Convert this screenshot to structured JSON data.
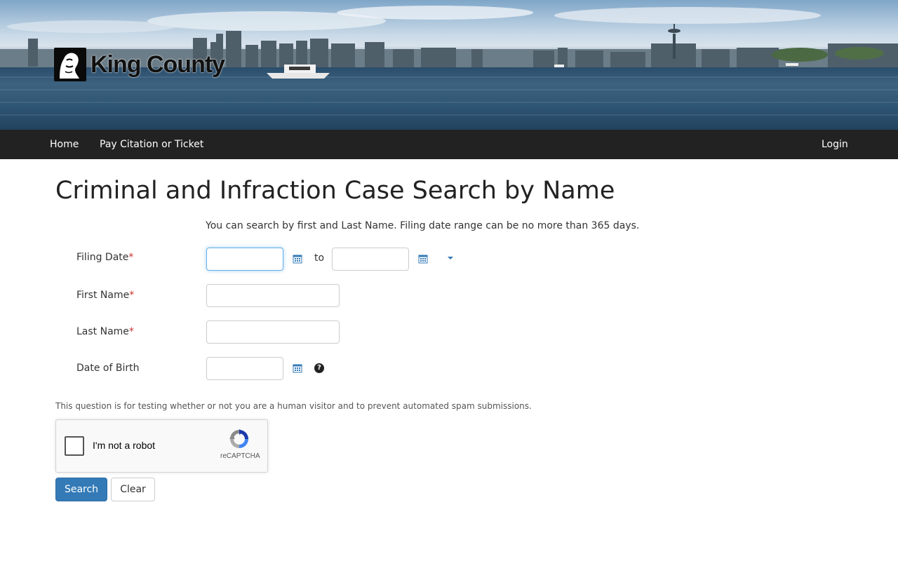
{
  "banner": {
    "logo_text": "King County"
  },
  "nav": {
    "home": "Home",
    "pay": "Pay Citation or Ticket",
    "login": "Login"
  },
  "main": {
    "title": "Criminal and Infraction Case Search by Name",
    "help_text": "You can search by first and Last Name. Filing date range can be no more than 365 days.",
    "fields": {
      "filing_date": {
        "label": "Filing Date",
        "required_mark": "*",
        "from_value": "",
        "to_value": ""
      },
      "to_label": "to",
      "first_name": {
        "label": "First Name",
        "required_mark": "*",
        "value": ""
      },
      "last_name": {
        "label": "Last Name",
        "required_mark": "*",
        "value": ""
      },
      "dob": {
        "label": "Date of Birth",
        "value": ""
      }
    },
    "help_icon": "?",
    "icons": [
      "calendar-icon",
      "caret-down-icon",
      "question-circle-icon",
      "recaptcha-logo-icon"
    ],
    "captcha": {
      "note": "This question is for testing whether or not you are a human visitor and to prevent automated spam submissions.",
      "label": "I'm not a robot",
      "brand": "reCAPTCHA",
      "checked": false
    },
    "buttons": {
      "search": "Search",
      "clear": "Clear"
    }
  },
  "colors": {
    "navbar_bg": "#222222",
    "primary_button": "#337ab7",
    "required": "#c9302c",
    "focus_border": "#66afe9",
    "calendar_icon": "#337ab7"
  }
}
